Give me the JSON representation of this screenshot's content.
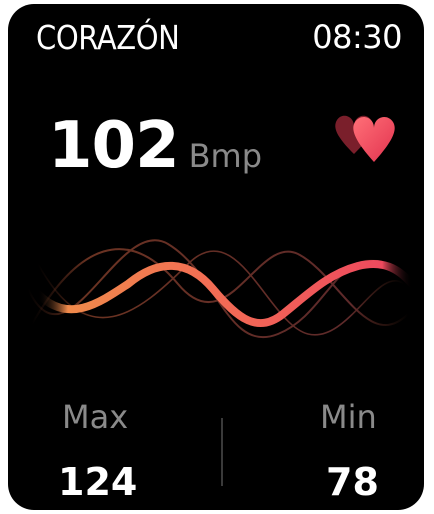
{
  "header": {
    "title": "CORAZÓN",
    "time": "08:30"
  },
  "heart_rate": {
    "value": "102",
    "unit": "Bmp"
  },
  "stats": {
    "max_label": "Max",
    "max_value": "124",
    "min_label": "Min",
    "min_value": "78"
  },
  "icons": {
    "heart": "heart-icon"
  },
  "colors": {
    "background": "#000000",
    "accent_start": "#f08a4b",
    "accent_end": "#ee3b5e",
    "secondary_text": "#8a8a8a"
  }
}
